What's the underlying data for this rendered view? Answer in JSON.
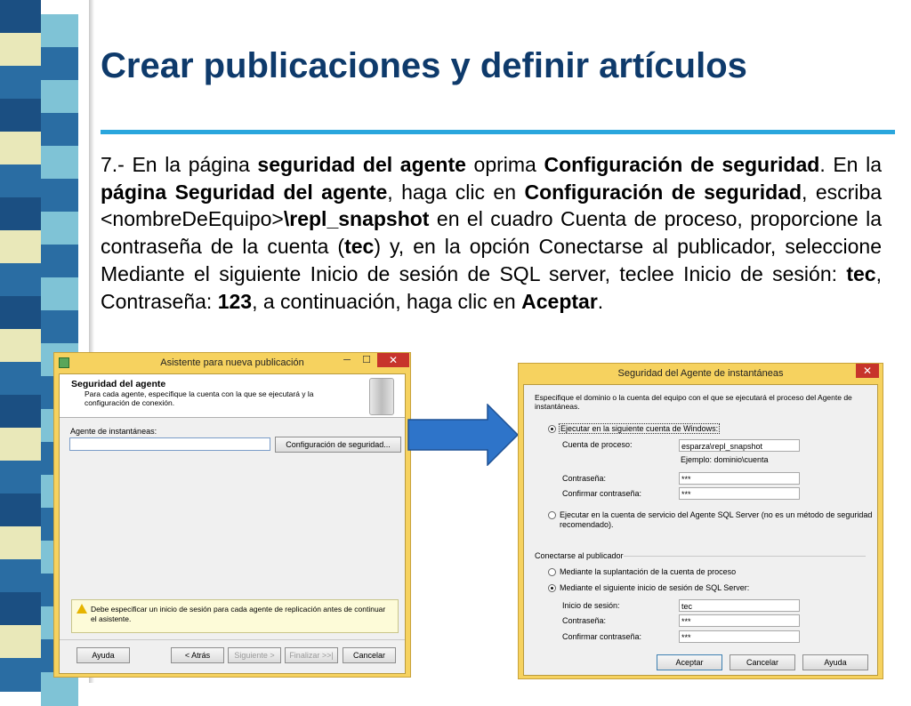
{
  "slide": {
    "title": "Crear publicaciones y definir artículos",
    "paragraph": [
      {
        "t": "7.- En la página ",
        "b": false
      },
      {
        "t": "seguridad del agente",
        "b": true
      },
      {
        "t": " oprima ",
        "b": false
      },
      {
        "t": "Configuración de seguridad",
        "b": true
      },
      {
        "t": ". En la ",
        "b": false
      },
      {
        "t": "página Seguridad del agente",
        "b": true
      },
      {
        "t": ", haga clic en ",
        "b": false
      },
      {
        "t": "Configuración de seguridad",
        "b": true
      },
      {
        "t": ", escriba <nombreDeEquipo>",
        "b": false
      },
      {
        "t": "\\repl_snapshot",
        "b": true
      },
      {
        "t": " en el cuadro Cuenta de proceso, proporcione la contraseña de la cuenta (",
        "b": false
      },
      {
        "t": "tec",
        "b": true
      },
      {
        "t": ") y, en la opción Conectarse al publicador, seleccione Mediante el siguiente Inicio de sesión de SQL server, teclee Inicio de sesión: ",
        "b": false
      },
      {
        "t": "tec",
        "b": true
      },
      {
        "t": ", Contraseña: ",
        "b": false
      },
      {
        "t": "123",
        "b": true
      },
      {
        "t": ", a continuación, haga clic en ",
        "b": false
      },
      {
        "t": "Aceptar",
        "b": true
      },
      {
        "t": ".",
        "b": false
      }
    ]
  },
  "colors": {
    "title": "#0e3a6b",
    "rule": "#2aa6dd",
    "window_frame": "#f6d25f",
    "close_button": "#c7342b",
    "arrow": "#2e74c9",
    "strip": [
      "#1b4f82",
      "#7fc3d6",
      "#e9e8b9",
      "#0d2f57",
      "#2a6da3",
      "#9bd0de"
    ]
  },
  "wizard": {
    "title": "Asistente para nueva publicación",
    "minimize": "─",
    "maximize": "☐",
    "close": "✕",
    "header_title": "Seguridad del agente",
    "header_desc_1": "Para cada agente, especifique la cuenta con la que se ejecutará y la",
    "header_desc_2": "configuración de conexión.",
    "agent_label": "Agente de instantáneas:",
    "agent_value": "",
    "security_button": "Configuración de seguridad...",
    "warning_icon": "warning-icon",
    "warning_1": "Debe especificar un inicio de sesión para cada agente de replicación antes de continuar",
    "warning_2": "el asistente.",
    "buttons": {
      "help": "Ayuda",
      "back": "< Atrás",
      "next": "Siguiente >",
      "finish": "Finalizar >>|",
      "cancel": "Cancelar"
    }
  },
  "security": {
    "title": "Seguridad del Agente de instantáneas",
    "close": "✕",
    "desc_1": "Especifique el dominio o la cuenta del equipo con el que se ejecutará el proceso del Agente de",
    "desc_2": "instantáneas.",
    "option_windows": "Ejecutar en la siguiente cuenta de Windows:",
    "process_account_label": "Cuenta de proceso:",
    "process_account_value": "esparza\\repl_snapshot",
    "example": "Ejemplo: dominio\\cuenta",
    "password_label": "Contraseña:",
    "password_value": "***",
    "confirm_label": "Confirmar contraseña:",
    "confirm_value": "***",
    "option_service_1": "Ejecutar en la cuenta de servicio del Agente SQL Server (no es un método de seguridad",
    "option_service_2": "recomendado).",
    "connect_section": "Conectarse al publicador",
    "option_impersonation": "Mediante la suplantación de la cuenta de proceso",
    "option_sql_login": "Mediante el siguiente inicio de sesión de SQL Server:",
    "login_label": "Inicio de sesión:",
    "login_value": "tec",
    "sql_password_label": "Contraseña:",
    "sql_password_value": "***",
    "sql_confirm_label": "Confirmar contraseña:",
    "sql_confirm_value": "***",
    "buttons": {
      "ok": "Aceptar",
      "cancel": "Cancelar",
      "help": "Ayuda"
    }
  }
}
